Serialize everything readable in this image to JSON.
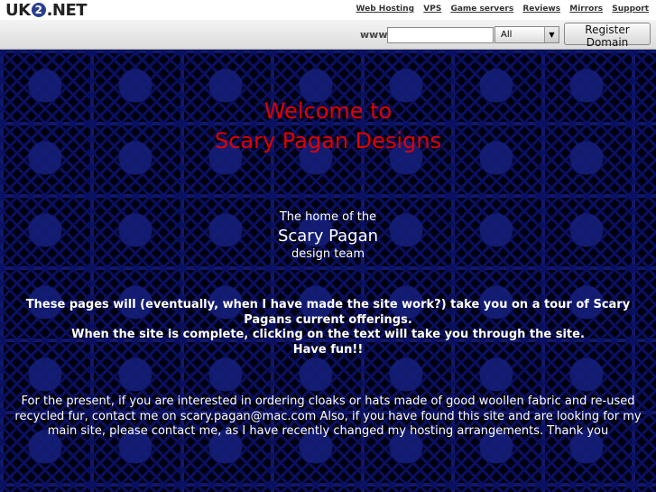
{
  "header": {
    "logo_left": "UK",
    "logo_mid": "2",
    "logo_right": ".NET",
    "nav": [
      "Web Hosting",
      "VPS",
      "Game servers",
      "Reviews",
      "Mirrors",
      "Support"
    ]
  },
  "search": {
    "prefix": "www.",
    "input_value": "",
    "tld_selected": "All",
    "button_label": "Register Domain"
  },
  "content": {
    "title_line1": "Welcome to",
    "title_line2": "Scary Pagan Designs",
    "intro_line1": "The home of the",
    "intro_line2": "Scary Pagan",
    "intro_line3": "design team",
    "tour_line1": "These pages will (eventually, when I have made the site work?) take you on a tour of Scary Pagans current offerings.",
    "tour_line2": "When the site is complete, clicking on the text will take you through the site.",
    "tour_line3": "Have fun!!",
    "present": "For the present, if you are interested in ordering cloaks or hats made of good woollen fabric and re-used recycled fur, contact me on scary.pagan@mac.com Also, if you have found this site and are looking for my main site, please contact me, as I have recently changed my hosting arrangements. Thank you"
  },
  "colors": {
    "title": "#e00000",
    "background": "#000010",
    "pattern": "#10186e",
    "logo_accent": "#2a3e8f"
  }
}
